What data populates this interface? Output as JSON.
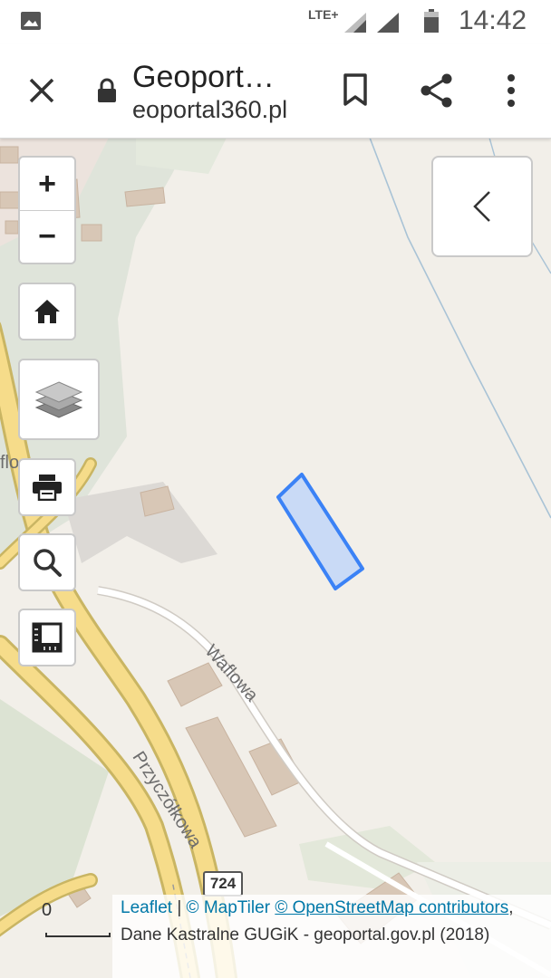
{
  "status_bar": {
    "network": "LTE+",
    "time": "14:42",
    "icons": [
      "image-icon",
      "signal-icon",
      "signal-icon",
      "battery-icon"
    ]
  },
  "browser": {
    "title": "Geoport…",
    "url": "eoportal360.pl",
    "icons": [
      "close-icon",
      "lock-icon",
      "bookmark-icon",
      "share-icon",
      "more-vert-icon"
    ]
  },
  "map": {
    "zoom_in_label": "+",
    "zoom_out_label": "−",
    "controls": [
      "home-icon",
      "layers-icon",
      "print-icon",
      "search-icon",
      "measure-icon",
      "chevron-left-icon"
    ],
    "streets": {
      "waflowa": "Waflowa",
      "przyczolkowa": "Przyczółkowa",
      "partial": "flo"
    },
    "road_number": "724",
    "scale_label": "0",
    "parcel_color": "#3b82f6",
    "attribution": {
      "leaflet": "Leaflet",
      "sep1": " | ",
      "maptiler": "© MapTiler",
      "osm": "© OpenStreetMap contributors",
      "rest": ", Dane Kastralne GUGiK - geoportal.gov.pl (2018)"
    }
  }
}
